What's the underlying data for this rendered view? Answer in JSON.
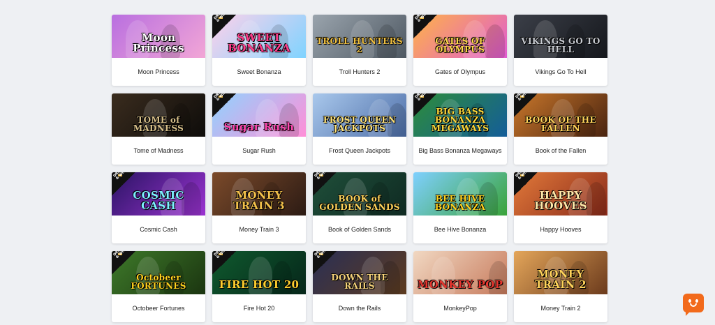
{
  "games": [
    {
      "title": "Moon Princess",
      "logo": "Moon Princess",
      "drops_wins": false,
      "bg": [
        "#b96fe0",
        "#f2a6d6"
      ],
      "logo_color": "#ffffff"
    },
    {
      "title": "Sweet Bonanza",
      "logo": "SWEET BONANZA",
      "drops_wins": true,
      "bg": [
        "#ffd1ea",
        "#7fd3ff"
      ],
      "logo_color": "#ff3d8b"
    },
    {
      "title": "Troll Hunters 2",
      "logo": "TROLL HUNTERS 2",
      "drops_wins": false,
      "bg": [
        "#9aa4ad",
        "#4e5862"
      ],
      "logo_color": "#f0c040"
    },
    {
      "title": "Gates of Olympus",
      "logo": "GATES OF OLYMPUS",
      "drops_wins": true,
      "bg": [
        "#ffb347",
        "#e05bd0"
      ],
      "logo_color": "#ffd84a"
    },
    {
      "title": "Vikings Go To Hell",
      "logo": "VIKINGS GO TO HELL",
      "drops_wins": false,
      "bg": [
        "#3b3f48",
        "#15171c"
      ],
      "logo_color": "#c9ccd2"
    },
    {
      "title": "Tome of Madness",
      "logo": "TOME of MADNESS",
      "drops_wins": false,
      "bg": [
        "#3a2c1e",
        "#0e0c0a"
      ],
      "logo_color": "#d8c08a"
    },
    {
      "title": "Sugar Rush",
      "logo": "Sugar Rush",
      "drops_wins": true,
      "bg": [
        "#8fd3ff",
        "#ff8fd8"
      ],
      "logo_color": "#ff48b0"
    },
    {
      "title": "Frost Queen Jackpots",
      "logo": "FROST QUEEN JACKPOTS",
      "drops_wins": false,
      "bg": [
        "#a9c8ec",
        "#4d6ea8"
      ],
      "logo_color": "#ffe37a"
    },
    {
      "title": "Big Bass Bonanza Megaways",
      "logo": "BIG BASS BONANZA MEGAWAYS",
      "drops_wins": true,
      "bg": [
        "#2d8d3a",
        "#145d99"
      ],
      "logo_color": "#ffd93b"
    },
    {
      "title": "Book of the Fallen",
      "logo": "BOOK OF THE FALLEN",
      "drops_wins": true,
      "bg": [
        "#c9772b",
        "#4a2410"
      ],
      "logo_color": "#ffd35a"
    },
    {
      "title": "Cosmic Cash",
      "logo": "COSMIC CASH",
      "drops_wins": true,
      "bg": [
        "#2a1464",
        "#9b33d1"
      ],
      "logo_color": "#7df0ff"
    },
    {
      "title": "Money Train 3",
      "logo": "MONEY TRAIN 3",
      "drops_wins": false,
      "bg": [
        "#7b4a2a",
        "#2c1b14"
      ],
      "logo_color": "#f5c24b"
    },
    {
      "title": "Book of Golden Sands",
      "logo": "BOOK of GOLDEN SANDS",
      "drops_wins": true,
      "bg": [
        "#1f4f3a",
        "#0f2a22"
      ],
      "logo_color": "#ffd35a"
    },
    {
      "title": "Bee Hive Bonanza",
      "logo": "BEE HIVE BONANZA",
      "drops_wins": false,
      "bg": [
        "#7fd0ff",
        "#3aa33a"
      ],
      "logo_color": "#ffd21f"
    },
    {
      "title": "Happy Hooves",
      "logo": "HAPPY HOOVES",
      "drops_wins": true,
      "bg": [
        "#e27a3a",
        "#8a2a1a"
      ],
      "logo_color": "#ffe7a8"
    },
    {
      "title": "Octobeer Fortunes",
      "logo": "Octobeer FORTUNES",
      "drops_wins": true,
      "bg": [
        "#3e7a2a",
        "#1b3510"
      ],
      "logo_color": "#ffd21f"
    },
    {
      "title": "Fire Hot 20",
      "logo": "FIRE HOT 20",
      "drops_wins": true,
      "bg": [
        "#0f5a2e",
        "#06261a"
      ],
      "logo_color": "#ffcf2e"
    },
    {
      "title": "Down the Rails",
      "logo": "DOWN THE RAILS",
      "drops_wins": true,
      "bg": [
        "#2a2f55",
        "#5d3b1f"
      ],
      "logo_color": "#f5d27a"
    },
    {
      "title": "MonkeyPop",
      "logo": "MONKEY POP",
      "drops_wins": false,
      "bg": [
        "#f1d8c2",
        "#c77a5c"
      ],
      "logo_color": "#e8362f"
    },
    {
      "title": "Money Train 2",
      "logo": "MONEY TRAIN 2",
      "drops_wins": false,
      "bg": [
        "#e4a65a",
        "#6b3a1c"
      ],
      "logo_color": "#ffd35a"
    }
  ],
  "badge_text": "DROPS\n& WINS",
  "chat": {
    "icon": "chat-smile-icon",
    "color": "#f26a1b"
  }
}
